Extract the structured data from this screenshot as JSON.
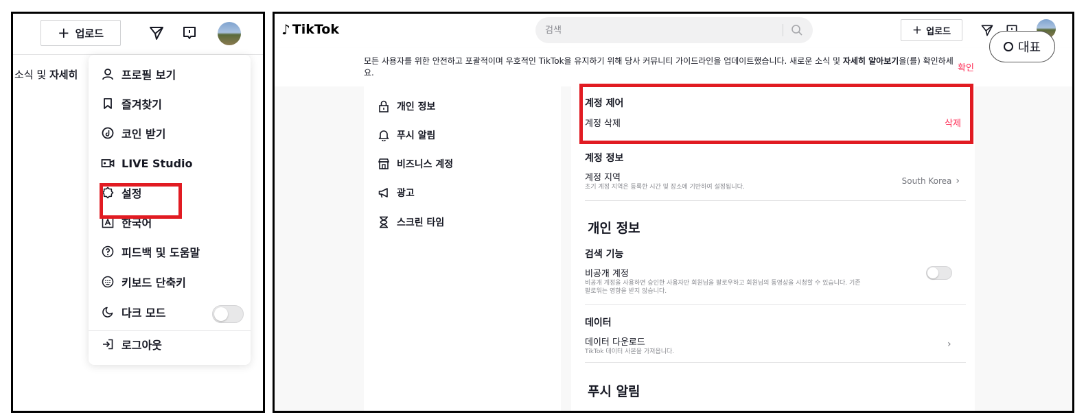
{
  "left": {
    "upload_label": "업로드",
    "notice_prefix": "소식 및 ",
    "notice_bold": "자세히",
    "menu": [
      {
        "label": "프로필 보기",
        "icon": "person-icon"
      },
      {
        "label": "즐겨찾기",
        "icon": "bookmark-icon"
      },
      {
        "label": "코인 받기",
        "icon": "coin-icon"
      },
      {
        "label": "LIVE Studio",
        "icon": "live-camera-icon"
      },
      {
        "label": "설정",
        "icon": "gear-icon"
      },
      {
        "label": "한국어",
        "icon": "language-icon"
      },
      {
        "label": "피드백 및 도움말",
        "icon": "help-icon"
      },
      {
        "label": "키보드 단축키",
        "icon": "keyboard-icon"
      },
      {
        "label": "다크 모드",
        "icon": "moon-icon"
      },
      {
        "label": "로그아웃",
        "icon": "logout-icon"
      }
    ],
    "dark_mode_on": false
  },
  "right": {
    "logo_text": "TikTok",
    "search_placeholder": "검색",
    "upload_label": "업로드",
    "rep_badge": "대표",
    "banner_text": "모든 사용자를 위한 안전하고 포괄적이며 우호적인 TikTok을 유지하기 위해 당사 커뮤니티 가이드라인을 업데이트했습니다. 새로운 소식 및 ",
    "banner_bold": "자세히 알아보기",
    "banner_suffix": "을(를) 확인하세요.",
    "banner_confirm": "확인",
    "nav": [
      {
        "label": "개인 정보",
        "icon": "lock-icon"
      },
      {
        "label": "푸시 알림",
        "icon": "bell-icon"
      },
      {
        "label": "비즈니스 계정",
        "icon": "store-icon"
      },
      {
        "label": "광고",
        "icon": "megaphone-icon"
      },
      {
        "label": "스크린 타임",
        "icon": "hourglass-icon"
      }
    ],
    "account_control": {
      "title": "계정 제어",
      "row_label": "계정 삭제",
      "action": "삭제"
    },
    "account_info": {
      "title": "계정 정보",
      "row_label": "계정 지역",
      "row_desc": "초기 계정 지역은 등록한 시간 및 장소에 기반하여 설정됩니다.",
      "value": "South Korea"
    },
    "privacy": {
      "heading": "개인 정보",
      "search_title": "검색 기능",
      "private_label": "비공개 계정",
      "private_desc_1": "비공개 계정을 사용하면 승인한 사용자만 회원님을 팔로우하고 회원님의 동영상을 시청할 수 있습니다. 기존",
      "private_desc_2": "팔로워는 영향을 받지 않습니다.",
      "private_on": false
    },
    "data": {
      "title": "데이터",
      "row_label": "데이터 다운로드",
      "row_desc": "TikTok 데이터 사본을 가져옵니다."
    },
    "push_heading": "푸시 알림"
  },
  "colors": {
    "accent": "#fe2c55",
    "highlight": "#e11b22",
    "text": "#161823"
  }
}
